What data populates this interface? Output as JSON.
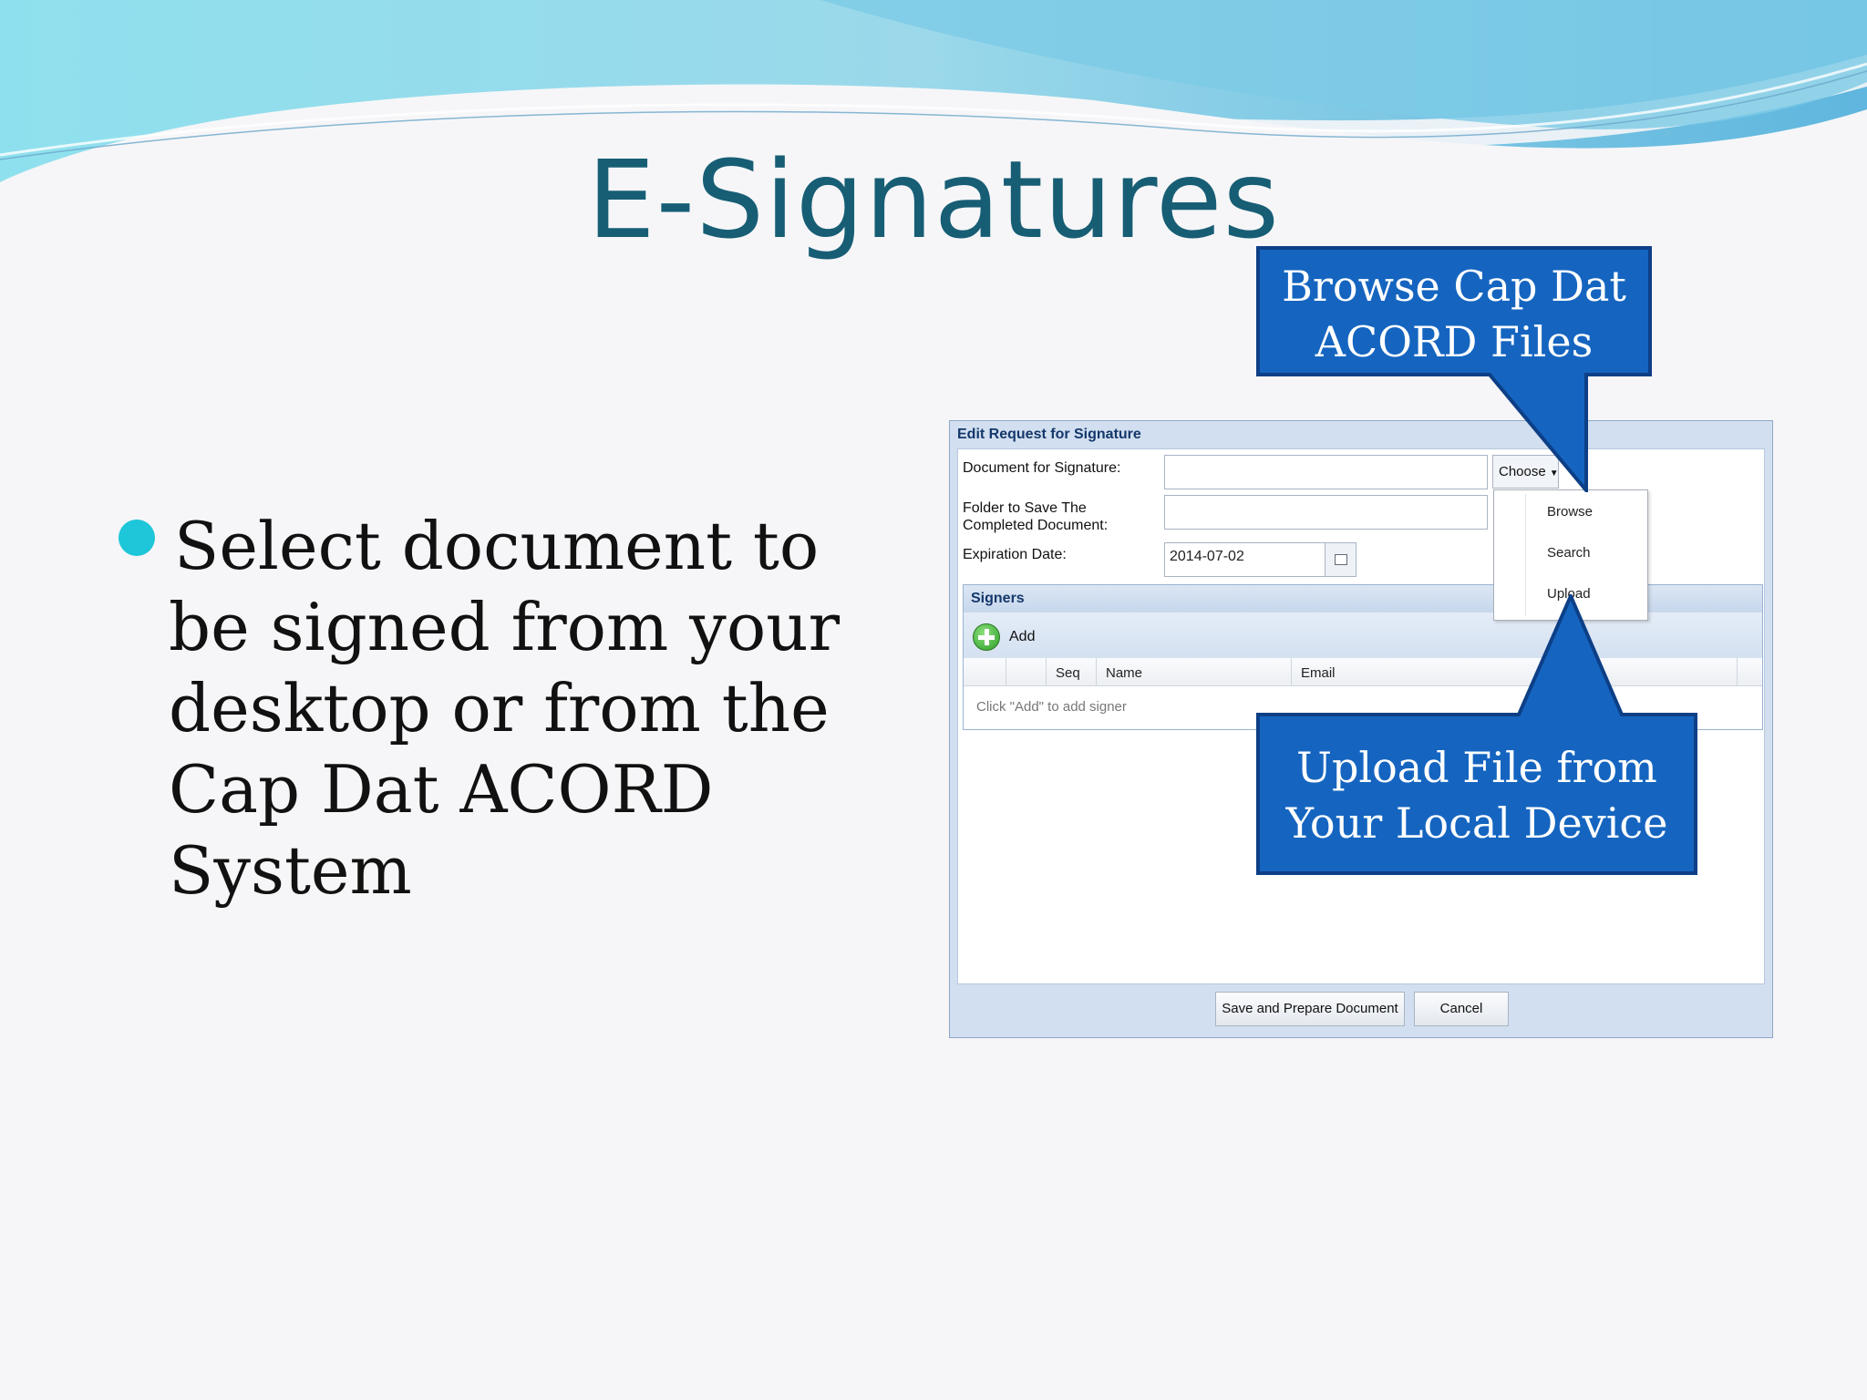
{
  "slide": {
    "title": "E-Signatures",
    "bullet": "Select document to be signed from your desktop or from the Cap Dat ACORD System"
  },
  "dialog": {
    "title": "Edit Request for Signature",
    "document_label": "Document for Signature:",
    "document_value": "",
    "folder_label_line1": "Folder to Save The",
    "folder_label_line2": "Completed Document:",
    "folder_value": "",
    "expiration_label": "Expiration Date:",
    "expiration_value": "2014-07-02",
    "choose_label": "Choose",
    "menu": [
      "Browse",
      "Search",
      "Upload"
    ],
    "signers_title": "Signers",
    "add_label": "Add",
    "columns": [
      "Seq",
      "Name",
      "Email"
    ],
    "empty_text": "Click \"Add\" to add signer",
    "save_label": "Save and Prepare Document",
    "cancel_label": "Cancel"
  },
  "callouts": {
    "browse_line1": "Browse Cap Dat",
    "browse_line2": "ACORD Files",
    "upload_line1": "Upload File from",
    "upload_line2": "Your Local Device"
  },
  "colors": {
    "title": "#175e75",
    "bullet": "#1dc6d8",
    "callout_fill": "#1565c0",
    "callout_border": "#0d3f86"
  }
}
